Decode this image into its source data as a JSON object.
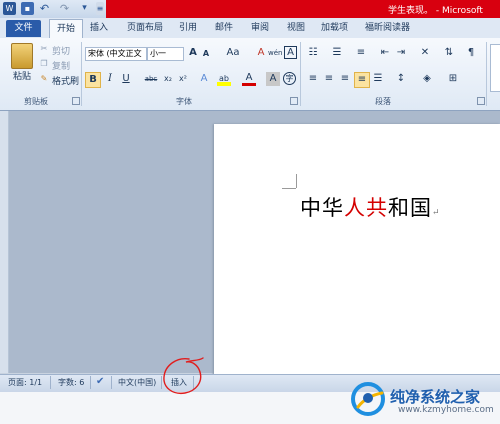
{
  "window": {
    "title": "学生表现。 - Microsoft"
  },
  "quick_access": [
    "word-logo-icon",
    "save-icon",
    "undo-icon",
    "redo-icon",
    "customize-icon"
  ],
  "tabs": [
    {
      "label": "文件"
    },
    {
      "label": "开始"
    },
    {
      "label": "插入"
    },
    {
      "label": "页面布局"
    },
    {
      "label": "引用"
    },
    {
      "label": "邮件"
    },
    {
      "label": "审阅"
    },
    {
      "label": "视图"
    },
    {
      "label": "加载项"
    },
    {
      "label": "福昕阅读器"
    }
  ],
  "clipboard": {
    "paste": "粘贴",
    "cut": "剪切",
    "copy": "复制",
    "format_painter": "格式刷",
    "group": "剪贴板"
  },
  "font": {
    "font_name": "宋体 (中文正文",
    "font_size": "小一",
    "grow": "A",
    "shrink": "A",
    "case": "Aa",
    "clear": "A",
    "phonetic": "wén",
    "char_border": "A",
    "bold": "B",
    "italic": "I",
    "underline": "U",
    "strike": "abc",
    "subscript": "x₂",
    "superscript": "x²",
    "text_effects": "A",
    "highlight": "ab",
    "font_color": "A",
    "char_shading": "A",
    "enclose": "字",
    "group": "字体"
  },
  "paragraph": {
    "group": "段落"
  },
  "document": {
    "text_before": "中华",
    "text_red": "人共",
    "text_after": "和国",
    "para_mark": "↵"
  },
  "status": {
    "page": "页面: 1/1",
    "words": "字数: 6",
    "language": "中文(中国)",
    "insert_mode": "插入"
  },
  "watermark": {
    "title": "纯净系统之家",
    "url": "www.kzmyhome.com"
  },
  "colors": {
    "accent_red": "#d8000f",
    "file_tab": "#2a5ba9",
    "annotation": "#e01e1e"
  }
}
